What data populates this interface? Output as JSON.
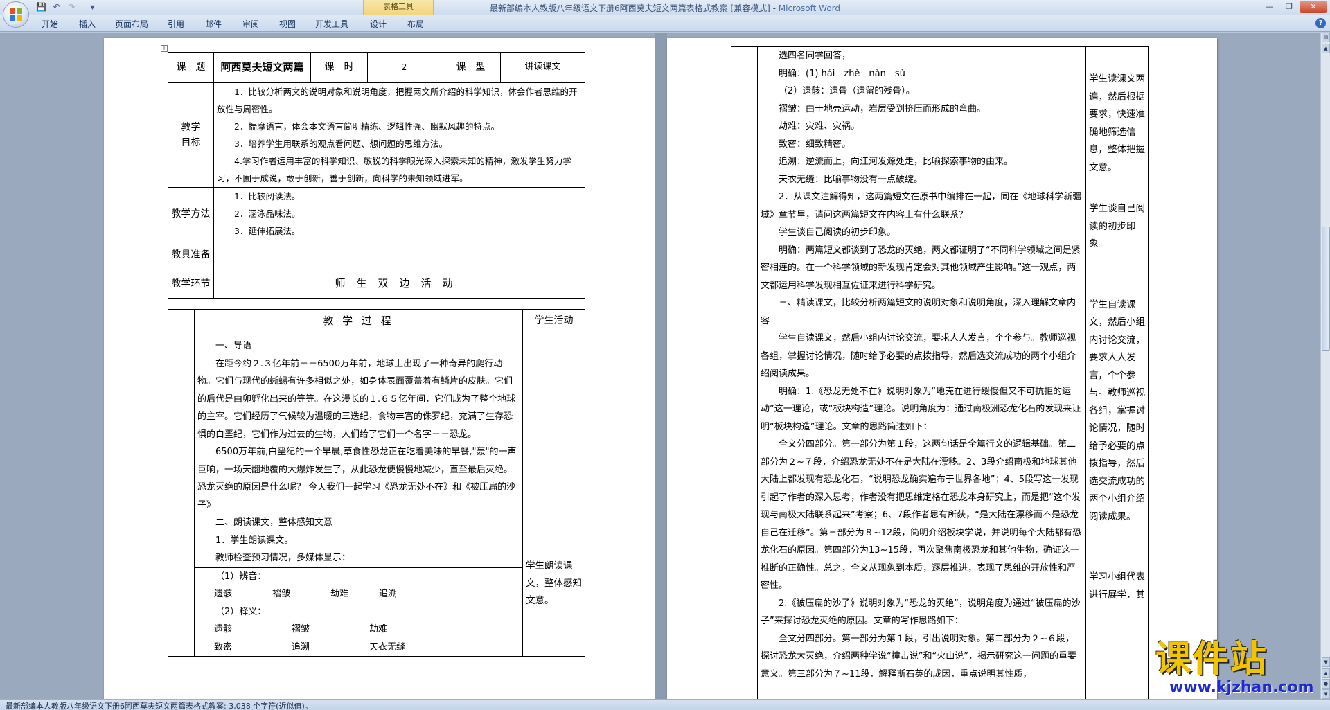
{
  "window": {
    "title_doc": "最新部编本人教版八年级语文下册6阿西莫夫短文两篇表格式教案 [兼容模式]",
    "title_sep": " - ",
    "title_app": "Microsoft Word",
    "context_tab_group": "表格工具"
  },
  "ribbon": {
    "tabs": [
      "开始",
      "插入",
      "页面布局",
      "引用",
      "邮件",
      "审阅",
      "视图",
      "开发工具",
      "设计",
      "布局"
    ]
  },
  "left_page": {
    "header": {
      "label_topic": "课　题",
      "title": "阿西莫夫短文两篇",
      "label_hours": "课　时",
      "hours": "2",
      "label_type": "课　型",
      "type": "讲读课文"
    },
    "goals_label": "教学目标",
    "goals": [
      "1．比较分析两文的说明对象和说明角度，把握两文所介绍的科学知识，体会作者思维的开放性与周密性。",
      "2．揣摩语言，体会本文语言简明精练、逻辑性强、幽默风趣的特点。",
      "3．培养学生用联系的观点看问题、想问题的思维方法。",
      "4.学习作者运用丰富的科学知识、敏锐的科学眼光深入探索未知的精神，激发学生努力学习，不囿于成说，敢于创新，善于创新，向科学的未知领域进军。"
    ],
    "methods_label": "教学方法",
    "methods": [
      "1．比较阅读法。",
      "2．涵泳品味法。",
      "3．延伸拓展法。"
    ],
    "tools_label": "教具准备",
    "tools": "",
    "stage_label": "教学环节",
    "stage_activity": "师生双边活动",
    "process_header": "教 学 过 程",
    "student_header": "学生活动",
    "process_lines": [
      "一、导语",
      "在距今约２.３亿年前－－6500万年前，地球上出现了一种奇异的爬行动物。它们与现代的蜥蜴有许多相似之处，如身体表面覆盖着有鳞片的皮肤。它们的后代是由卵孵化出来的等等。在这漫长的１.６５亿年间，它们成为了整个地球的主宰。它们经历了气候较为温暖的三迭纪，食物丰富的侏罗纪，充满了生存恐惧的白垩纪，它们作为过去的生物，人们给了它们一个名字－－恐龙。",
      "6500万年前,白垩纪的一个早晨,草食性恐龙正在吃着美味的早餐,\"轰\"的一声巨响，一场天翻地覆的大爆炸发生了，从此恐龙便慢慢地减少，直至最后灭绝。恐龙灭绝的原因是什么呢？ 今天我们一起学习《恐龙无处不在》和《被压扁的沙子》",
      "二、朗读课文，整体感知文意",
      "1．学生朗读课文。",
      "教师检查预习情况，多媒体显示："
    ],
    "box": {
      "pron_label": "（1）辨音：",
      "pron_words": [
        "遗骸",
        "褶皱",
        "劫难",
        "追溯"
      ],
      "def_label": "（2）释义：",
      "def_row1": [
        "遗骸",
        "褶皱",
        "劫难"
      ],
      "def_row2": [
        "致密",
        "追溯",
        "天衣无缝"
      ]
    },
    "student_activity": "学生朗读课文，整体感知文意。"
  },
  "right_page": {
    "lines": [
      "选四名同学回答，",
      "明确：(1) hái　zhě　nàn　sù",
      "（2）遗骸：遗骨（遗留的残骨）。",
      "褶皱：由于地壳运动，岩层受到挤压而形成的弯曲。",
      "劫难：灾难、灾祸。",
      "致密：细致精密。",
      "追溯：逆流而上，向江河发源处走，比喻探索事物的由来。",
      "天衣无缝：比喻事物没有一点破绽。",
      "2．从课文注解得知，这两篇短文在原书中编排在一起，同在《地球科学新疆域》章节里，请问这两篇短文在内容上有什么联系？",
      "学生谈自己阅读的初步印象。",
      "明确：两篇短文都谈到了恐龙的灭绝，两文都证明了“不同科学领域之间是紧密相连的。在一个科学领域的新发现肯定会对其他领域产生影响。”这一观点，两文都运用科学发现相互佐证来进行科学研究。",
      "三、精读课文，比较分析两篇短文的说明对象和说明角度，深入理解文章内容",
      "学生自读课文，然后小组内讨论交流，要求人人发言，个个参与。教师巡视各组，掌握讨论情况，随时给予必要的点拨指导，然后选交流成功的两个小组介绍阅读成果。",
      "明确：1.《恐龙无处不在》说明对象为“地壳在进行缓慢但又不可抗拒的运动”这一理论，或“板块构造”理论。说明角度为：通过南极洲恐龙化石的发现来证明“板块构造”理论。文章的思路简述如下：",
      "全文分四部分。第一部分为第１段，这两句话是全篇行文的逻辑基础。第二部分为２~７段，介绍恐龙无处不在是大陆在漂移。2、3段介绍南极和地球其他大陆上都发现有恐龙化石，“说明恐龙确实遍布于世界各地”；4、5段写这一发现引起了作者的深入思考，作者没有把思维定格在恐龙本身研究上，而是把“这个发现与南极大陆联系起来”考察；6、7段作者思有所获，“是大陆在漂移而不是恐龙自己在迁移”。第三部分为８~12段，简明介绍板块学说，并说明每个大陆都有恐龙化石的原因。第四部分为13~15段，再次聚焦南极恐龙和其他生物，确证这一推断的正确性。总之，全文从现象到本质，逐层推进，表现了思维的开放性和严密性。",
      "2.《被压扁的沙子》说明对象为“恐龙的灭绝”，说明角度为通过“被压扁的沙子”来探讨恐龙灭绝的原因。文章的写作思路如下：",
      "全文分四部分。第一部分为第１段，引出说明对象。第二部分为２~６段，探讨恐龙大灭绝，介绍两种学说“撞击说”和“火山说”，揭示研究这一问题的重要意义。第三部分为７~11段，解释斯石英的成因，重点说明其性质，"
    ],
    "side_notes": [
      "学生读课文两遍，然后根据要求，快速准确地筛选信息，整体把握文意。",
      "学生谈自己阅读的初步印象。",
      "学生自读课文，然后小组内讨论交流，要求人人发言，个个参与。教师巡视各组，掌握讨论情况，随时给予必要的点拨指导，然后选交流成功的两个小组介绍阅读成果。",
      "学习小组代表进行展学，其"
    ]
  },
  "status": {
    "text": "最新部编本人教版八年级语文下册6阿西莫夫短文两篇表格式教案: 3,038 个字符(近似值)。"
  },
  "watermark": {
    "brand": "课件站",
    "url": "www.kjzhan.com"
  },
  "colors": {
    "ribbon_bg": "#cfdcee",
    "workspace_bg": "#9aa9bd",
    "context_tab": "#f2d680",
    "close_button": "#c8452a"
  }
}
